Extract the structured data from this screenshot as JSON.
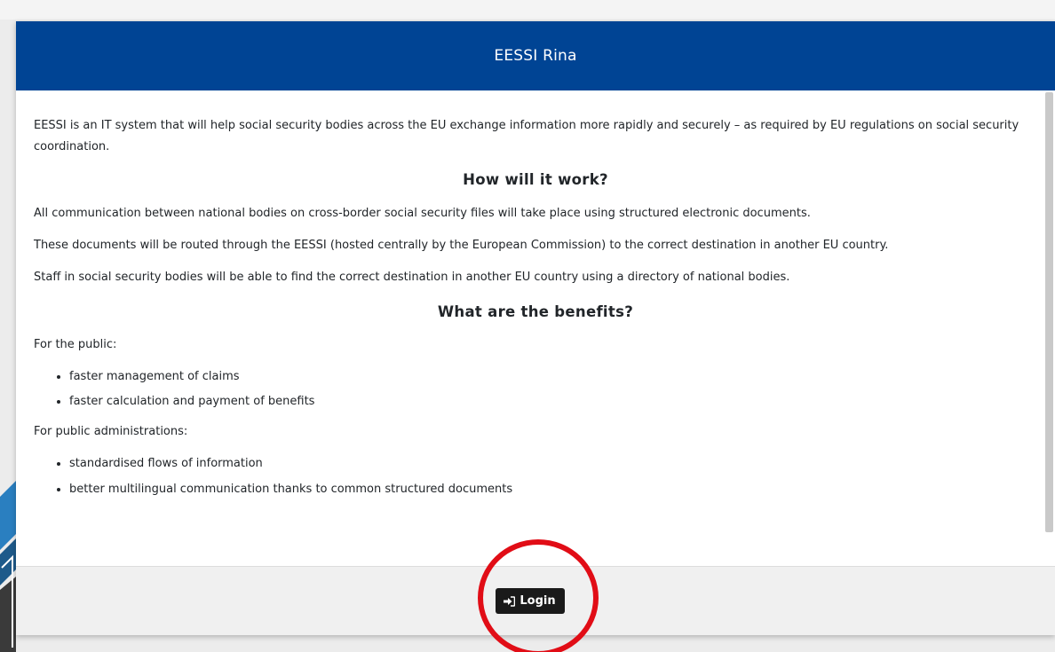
{
  "modal": {
    "title": "EESSI Rina",
    "intro": "EESSI is an IT system that will help social security bodies across the EU exchange information more rapidly and securely – as required by EU regulations on social security coordination.",
    "section1": {
      "heading": "How will it work?",
      "paragraphs": [
        "All communication between national bodies on cross-border social security files will take place using structured electronic documents.",
        "These documents will be routed through the EESSI (hosted centrally by the European Commission) to the correct destination in another EU country.",
        "Staff in social security bodies will be able to find the correct destination in another EU country using a directory of national bodies."
      ]
    },
    "section2": {
      "heading": "What are the benefits?",
      "public_label": "For the public:",
      "public_items": [
        "faster management of claims",
        "faster calculation and payment of benefits"
      ],
      "admin_label": "For public administrations:",
      "admin_items": [
        "standardised flows of information",
        "better multilingual communication thanks to common structured documents"
      ]
    },
    "footer": {
      "login_label": "Login"
    }
  },
  "colors": {
    "header_bg": "#004494",
    "button_bg": "#1a1a1a",
    "highlight_ring": "#e10d16"
  },
  "icons": {
    "login": "sign-in-icon"
  }
}
